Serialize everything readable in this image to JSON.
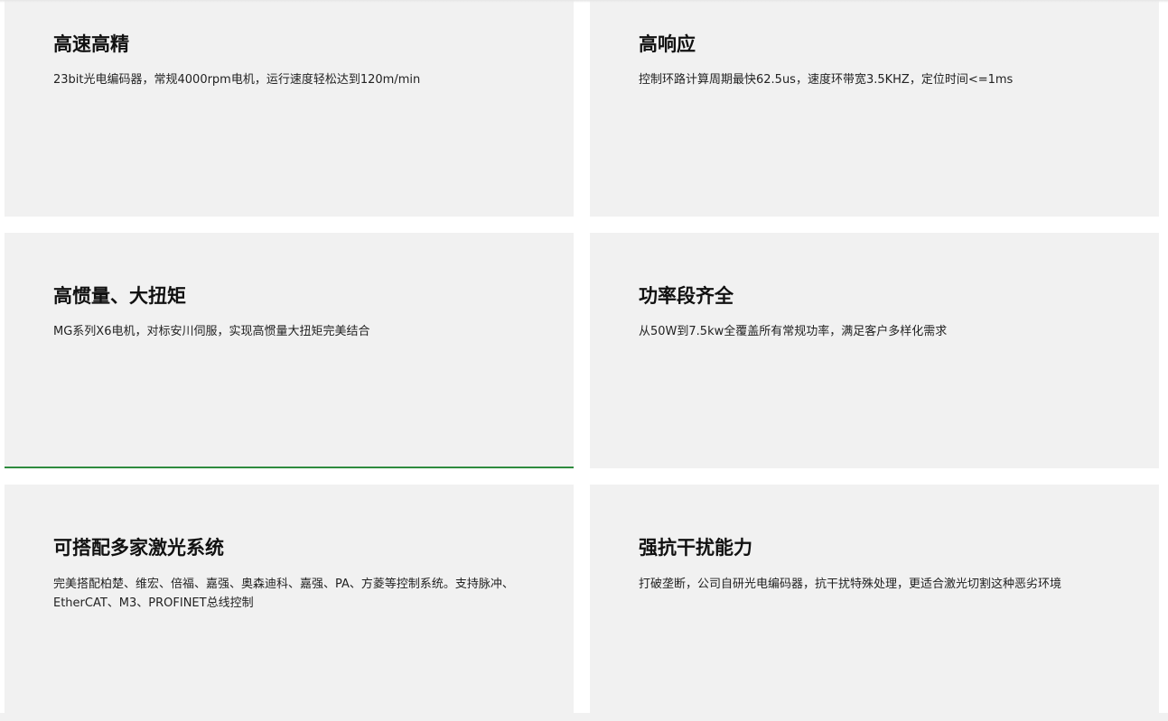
{
  "features": [
    {
      "title": "高速高精",
      "description": "23bit光电编码器，常规4000rpm电机，运行速度轻松达到120m/min"
    },
    {
      "title": "高响应",
      "description": "控制环路计算周期最快62.5us，速度环带宽3.5KHZ，定位时间<=1ms"
    },
    {
      "title": "高惯量、大扭矩",
      "description": "MG系列X6电机，对标安川伺服，实现高惯量大扭矩完美结合"
    },
    {
      "title": "功率段齐全",
      "description": "从50W到7.5kw全覆盖所有常规功率，满足客户多样化需求"
    },
    {
      "title": "可搭配多家激光系统",
      "description": "完美搭配柏楚、维宏、倍福、嘉强、奥森迪科、嘉强、PA、方菱等控制系统。支持脉冲、EtherCAT、M3、PROFINET总线控制"
    },
    {
      "title": "强抗干扰能力",
      "description": "打破垄断，公司自研光电编码器，抗干扰特殊处理，更适合激光切割这种恶劣环境"
    }
  ]
}
